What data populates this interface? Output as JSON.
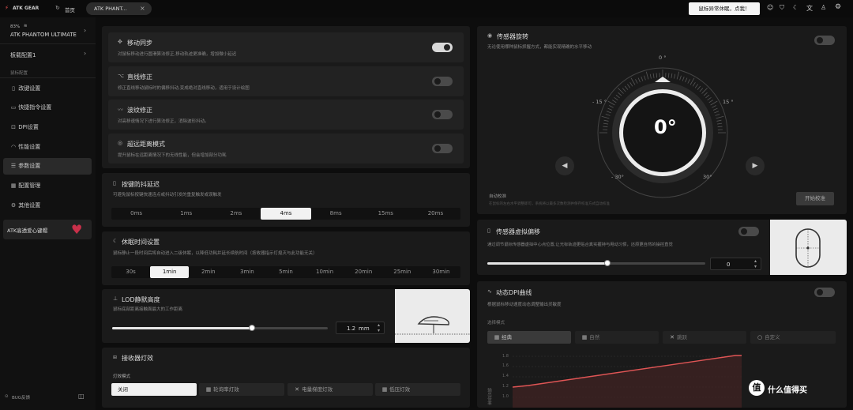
{
  "topbar": {
    "logo": "ATK GEAR",
    "home": "首页",
    "tab": "ATK PHANT...",
    "tab_close": "×",
    "notice_button": "鼠标异常休眠，点我！"
  },
  "device": {
    "battery": "83%",
    "name": "ATK PHANTOM ULTIMATE"
  },
  "sidebar": {
    "profile": "板载配置1",
    "section_label": "鼠标配置",
    "items": [
      {
        "label": "改键设置",
        "icon": "key-icon"
      },
      {
        "label": "快捷指令设置",
        "icon": "terminal-icon"
      },
      {
        "label": "DPI设置",
        "icon": "dpi-icon"
      },
      {
        "label": "性能设置",
        "icon": "gauge-icon"
      },
      {
        "label": "参数设置",
        "icon": "sliders-icon"
      },
      {
        "label": "配置管理",
        "icon": "grid-icon"
      },
      {
        "label": "其他设置",
        "icon": "gear-icon"
      }
    ],
    "promo": "ATK高透爱心键帽",
    "feedback": "BUG反馈"
  },
  "motion": {
    "rows": [
      {
        "title": "移动同步",
        "desc": "对鼠标移动进行圆滑算法修正,移动轨迹更准确，增加微小延迟",
        "on": true
      },
      {
        "title": "直线修正",
        "desc": "修正直线移动鼠标时的偏移抖动,变成绝对直线移动，适用于设计绘图",
        "on": false
      },
      {
        "title": "波纹修正",
        "desc": "对高移速情况下进行算法修正，消除波形抖动。",
        "on": false
      },
      {
        "title": "超远距离模式",
        "desc": "提升鼠标在远距离情况下的无线性能，但会增加部分功耗",
        "on": false
      }
    ]
  },
  "debounce": {
    "title": "按键防抖延迟",
    "desc": "可避免鼠标按键快速连点或抖动引发的重复触发或误触发",
    "options": [
      "0ms",
      "1ms",
      "2ms",
      "4ms",
      "8ms",
      "15ms",
      "20ms"
    ],
    "selected": 3
  },
  "sleep": {
    "title": "休眠时间设置",
    "desc": "鼠标静止一段时间后将自动进入二级休眠，以降低功耗并延长续航时间（按收器指示灯熄灭与此功能无关）",
    "options": [
      "30s",
      "1min",
      "2min",
      "3min",
      "5min",
      "10min",
      "20min",
      "25min",
      "30min"
    ],
    "selected": 1
  },
  "lod": {
    "title": "LOD静默高度",
    "desc": "鼠标底部距离接触面最大的工作距离",
    "value": "1.2",
    "unit": "mm",
    "fill": 0.65
  },
  "receiver": {
    "title": "接收器灯效",
    "mode_label": "灯效模式",
    "modes": [
      "关闭",
      "轮询率灯效",
      "电量梯度灯效",
      "低压灯效"
    ],
    "selected": 0
  },
  "rotation": {
    "title": "传感器旋转",
    "desc": "无论使用哪种鼠标抓握方式，都能实现精确的水平移动",
    "value": "0°",
    "ticks": [
      "0 °",
      "- 15 °",
      "15 °",
      "- 30°",
      "30°"
    ],
    "auto_title": "自动校准",
    "auto_desc": "在鼠标的左右水平调整即可，系统将以最多次数检测并保存校准方式自动校准",
    "auto_button": "开始校准",
    "on": false
  },
  "offset": {
    "title": "传感器虚拟偏移",
    "desc": "通过调节鼠标传感器虚拟中心点位置,让光标轨迹更贴合真实握持与甩动习惯，还原更自然的操控直觉",
    "value": "0",
    "fill": 0.55,
    "on": false
  },
  "dpi_curve": {
    "title": "动态DPI曲线",
    "desc": "根据鼠标移动速度动态调整输出灵敏度",
    "mode_label": "选择模式",
    "modes": [
      "经典",
      "自然",
      "跳跃",
      "自定义"
    ],
    "selected": 0,
    "on": false,
    "y_ticks": [
      "1.8",
      "1.6",
      "1.4",
      "1.2",
      "1.0"
    ],
    "y_label": "输出倍率"
  },
  "watermark": "值 什么值得买"
}
